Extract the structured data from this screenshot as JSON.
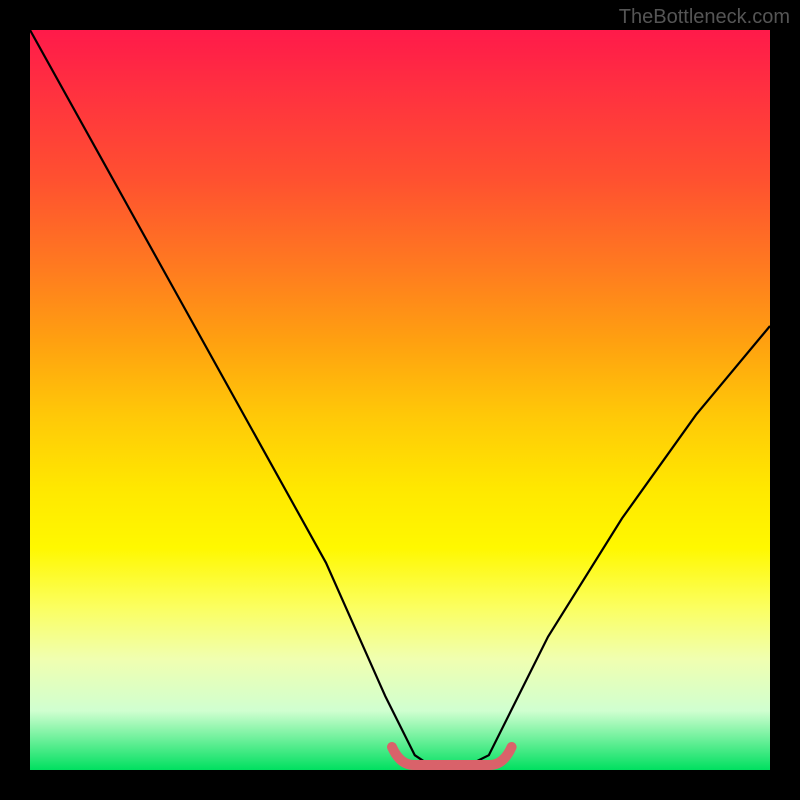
{
  "watermark": "TheBottleneck.com",
  "chart_data": {
    "type": "line",
    "title": "",
    "xlabel": "",
    "ylabel": "",
    "xlim": [
      0,
      100
    ],
    "ylim": [
      0,
      100
    ],
    "series": [
      {
        "name": "bottleneck-curve",
        "x": [
          0,
          10,
          20,
          30,
          40,
          48,
          52,
          55,
          58,
          62,
          65,
          70,
          80,
          90,
          100
        ],
        "values": [
          100,
          82,
          64,
          46,
          28,
          10,
          2,
          0,
          0,
          2,
          8,
          18,
          34,
          48,
          60
        ]
      }
    ],
    "annotations": [
      {
        "name": "flat-minimum-highlight",
        "color": "#d9626a",
        "x_range": [
          50,
          64
        ],
        "y": 0
      }
    ]
  }
}
